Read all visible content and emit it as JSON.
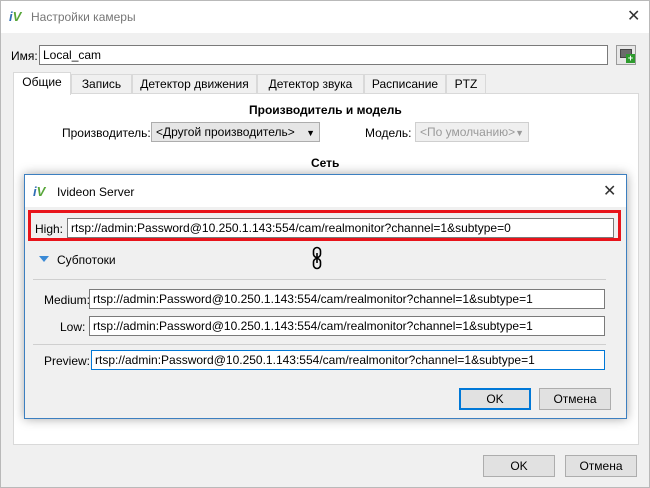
{
  "main": {
    "title": "Настройки камеры",
    "name_label": "Имя:",
    "name_value": "Local_cam",
    "tabs": [
      {
        "label": "Общие"
      },
      {
        "label": "Запись"
      },
      {
        "label": "Детектор движения"
      },
      {
        "label": "Детектор звука"
      },
      {
        "label": "Расписание"
      },
      {
        "label": "PTZ"
      }
    ],
    "section_vendor": "Производитель и модель",
    "vendor_label": "Производитель:",
    "vendor_value": "<Другой производитель>",
    "model_label": "Модель:",
    "model_value": "<По умолчанию>",
    "section_network": "Сеть",
    "ok_label": "OK",
    "cancel_label": "Отмена"
  },
  "dialog": {
    "title": "Ivideon Server",
    "high_label": "High:",
    "high_value": "rtsp://admin:Password@10.250.1.143:554/cam/realmonitor?channel=1&subtype=0",
    "substreams_label": "Субпотоки",
    "medium_label": "Medium:",
    "medium_value": "rtsp://admin:Password@10.250.1.143:554/cam/realmonitor?channel=1&subtype=1",
    "low_label": "Low:",
    "low_value": "rtsp://admin:Password@10.250.1.143:554/cam/realmonitor?channel=1&subtype=1",
    "preview_label": "Preview:",
    "preview_value": "rtsp://admin:Password@10.250.1.143:554/cam/realmonitor?channel=1&subtype=1",
    "ok_label": "OK",
    "cancel_label": "Отмена"
  },
  "icons": {
    "app_logo_text": "iV",
    "close_glyph": "✕",
    "dropdown_glyph": "▼"
  },
  "colors": {
    "accent": "#0078d7",
    "highlight": "#e8141b",
    "logo_blue": "#2f6db5",
    "logo_green": "#58a63a"
  }
}
